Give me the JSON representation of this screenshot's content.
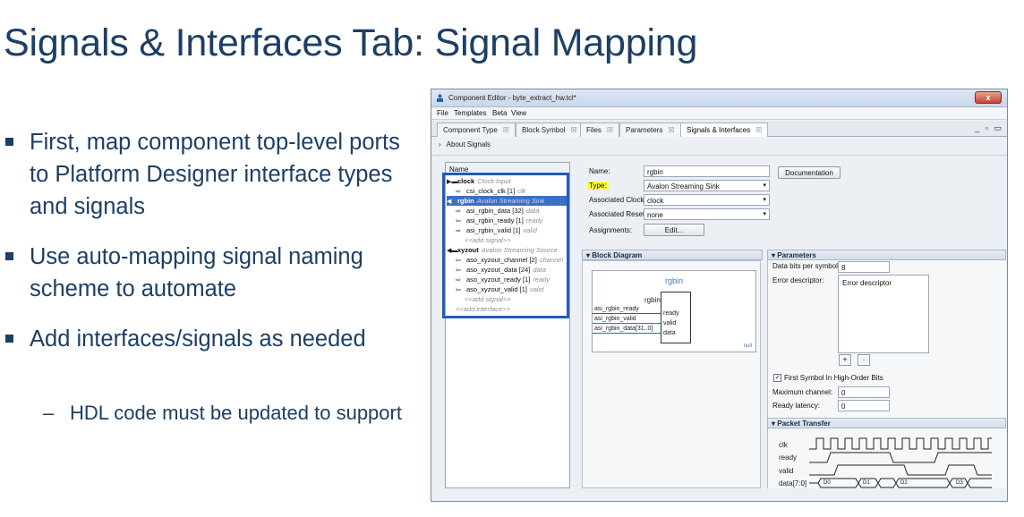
{
  "slide": {
    "title": "Signals & Interfaces Tab: Signal Mapping",
    "bullets": [
      "First, map component top-level ports to Platform Designer interface types and signals",
      "Use auto-mapping signal naming scheme to automate",
      "Add interfaces/signals as needed"
    ],
    "sub_bullets": [
      "HDL code must be updated to support"
    ],
    "dash_glyph": "–"
  },
  "window": {
    "title": "Component Editor - byte_extract_hw.tcl*",
    "close_glyph": "x",
    "menu": [
      "File",
      "Templates",
      "Beta",
      "View"
    ],
    "tabs": [
      "Component Type",
      "Block Symbol",
      "Files",
      "Parameters",
      "Signals & Interfaces"
    ],
    "active_tab": "Signals & Interfaces",
    "tab_close_glyph": "☒",
    "window_controls": "_ ▫ ▭",
    "about_chev": "›",
    "about_label": "About Signals"
  },
  "tree": {
    "header": "Name",
    "rows": [
      {
        "icon": "▶▬",
        "name": "clock",
        "sub": "Clock Input",
        "bold": true,
        "selected": false,
        "indent": 0
      },
      {
        "icon": "⇨",
        "name": "csi_clock_clk [1]",
        "sub": "clk",
        "bold": false,
        "selected": false,
        "indent": 1
      },
      {
        "icon": "◀",
        "name": "rgbin",
        "sub": "Avalon Streaming Sink",
        "bold": true,
        "selected": true,
        "indent": 0
      },
      {
        "icon": "⇨",
        "name": "asi_rgbin_data [32]",
        "sub": "data",
        "bold": false,
        "selected": false,
        "indent": 1
      },
      {
        "icon": "⇦",
        "name": "asi_rgbin_ready [1]",
        "sub": "ready",
        "bold": false,
        "selected": false,
        "indent": 1
      },
      {
        "icon": "⇨",
        "name": "asi_rgbin_valid [1]",
        "sub": "valid",
        "bold": false,
        "selected": false,
        "indent": 1
      },
      {
        "icon": "",
        "name": "",
        "sub": "",
        "add": "<<add signal>>",
        "bold": false,
        "selected": false,
        "indent": 1
      },
      {
        "icon": "◀▬",
        "name": "xyzout",
        "sub": "Avalon Streaming Source",
        "bold": true,
        "selected": false,
        "indent": 0
      },
      {
        "icon": "⇦",
        "name": "aso_xyzout_channel [2]",
        "sub": "channel",
        "bold": false,
        "selected": false,
        "indent": 1
      },
      {
        "icon": "⇦",
        "name": "aso_xyzout_data [24]",
        "sub": "data",
        "bold": false,
        "selected": false,
        "indent": 1
      },
      {
        "icon": "⇨",
        "name": "aso_xyzout_ready [1]",
        "sub": "ready",
        "bold": false,
        "selected": false,
        "indent": 1
      },
      {
        "icon": "⇦",
        "name": "aso_xyzout_valid [1]",
        "sub": "valid",
        "bold": false,
        "selected": false,
        "indent": 1
      },
      {
        "icon": "",
        "name": "",
        "sub": "",
        "add": "<<add signal>>",
        "bold": false,
        "selected": false,
        "indent": 1
      },
      {
        "icon": "",
        "name": "",
        "sub": "",
        "add": "<<add interface>>",
        "bold": false,
        "selected": false,
        "indent": 0
      }
    ]
  },
  "form": {
    "name_label": "Name:",
    "name_value": "rgbin",
    "type_label": "Type:",
    "type_value": "Avalon Streaming Sink",
    "clock_label": "Associated Clock:",
    "clock_value": "clock",
    "reset_label": "Associated Reset:",
    "reset_value": "none",
    "assign_label": "Assignments:",
    "edit_button": "Edit...",
    "doc_button": "Documentation",
    "dropdown_glyph": "▾"
  },
  "block_diagram": {
    "header": "Block Diagram",
    "header_chev": "▾",
    "title": "rgbin",
    "box_label": "rgbin",
    "signals": [
      "asi_rgbin_ready",
      "asi_rgbin_valid",
      "asi_rgbin_data[31..0]"
    ],
    "ports": [
      "ready",
      "valid",
      "data"
    ],
    "null_label": "null"
  },
  "parameters": {
    "header": "Parameters",
    "header_chev": "▾",
    "data_bits_label": "Data bits per symbol:",
    "data_bits_value": "8",
    "error_label": "Error descriptor:",
    "error_item": "Error descriptor",
    "add_glyph": "+",
    "remove_glyph": "-",
    "check_glyph": "✓",
    "first_symbol_label": "First Symbol In High-Order Bits",
    "first_symbol_checked": true,
    "max_channel_label": "Maximum channel:",
    "max_channel_value": "0",
    "ready_latency_label": "Ready latency:",
    "ready_latency_value": "0"
  },
  "packet_transfer": {
    "header": "Packet Transfer",
    "header_chev": "▾",
    "signals": [
      "clk",
      "ready",
      "valid",
      "data[7:0]"
    ],
    "data_values": [
      "D0",
      "D1",
      "D2",
      "D3"
    ]
  }
}
